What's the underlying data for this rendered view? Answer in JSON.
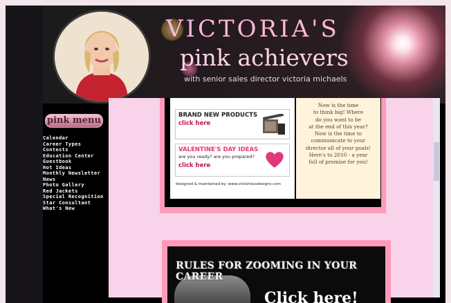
{
  "header": {
    "title_line1": "VICTORIA'S",
    "title_line2": "pink achievers",
    "subtitle": "with senior sales director victoria michaels"
  },
  "sidebar": {
    "menu_label": "pink menu",
    "items": [
      "Calendar",
      "Career Types",
      "Contests",
      "Education Center",
      "Guestbook",
      "Hot Ideas",
      "Monthly Newsletter",
      "News",
      "Photo Gallery",
      "Red Jackets",
      "Special Recognition",
      "Star Consultant",
      "What's New"
    ]
  },
  "ads": {
    "products": {
      "title": "BRAND NEW PRODUCTS",
      "link": "click here"
    },
    "valentine": {
      "title": "VALENTINE'S DAY IDEAS",
      "sub": "are you ready? are you prepared?",
      "link": "click here"
    },
    "credit": "designed & maintained by: www.victoriousdesigns.com"
  },
  "quote": {
    "lines": [
      "Now is the time",
      "to think big! Where",
      "do you want to be",
      "at the end of this year?",
      "Now is the time to",
      "communicate to your",
      "director all of your goals!",
      "Here's to 2010 - a year",
      "full of promise for you!"
    ]
  },
  "career_banner": {
    "title": "RULES FOR ZOOMING IN YOUR CAREER",
    "cta": "Click here!"
  },
  "colors": {
    "pink_bg": "#f8d3ea",
    "pink_border": "#ff9ab9",
    "link_red": "#c0154b"
  }
}
